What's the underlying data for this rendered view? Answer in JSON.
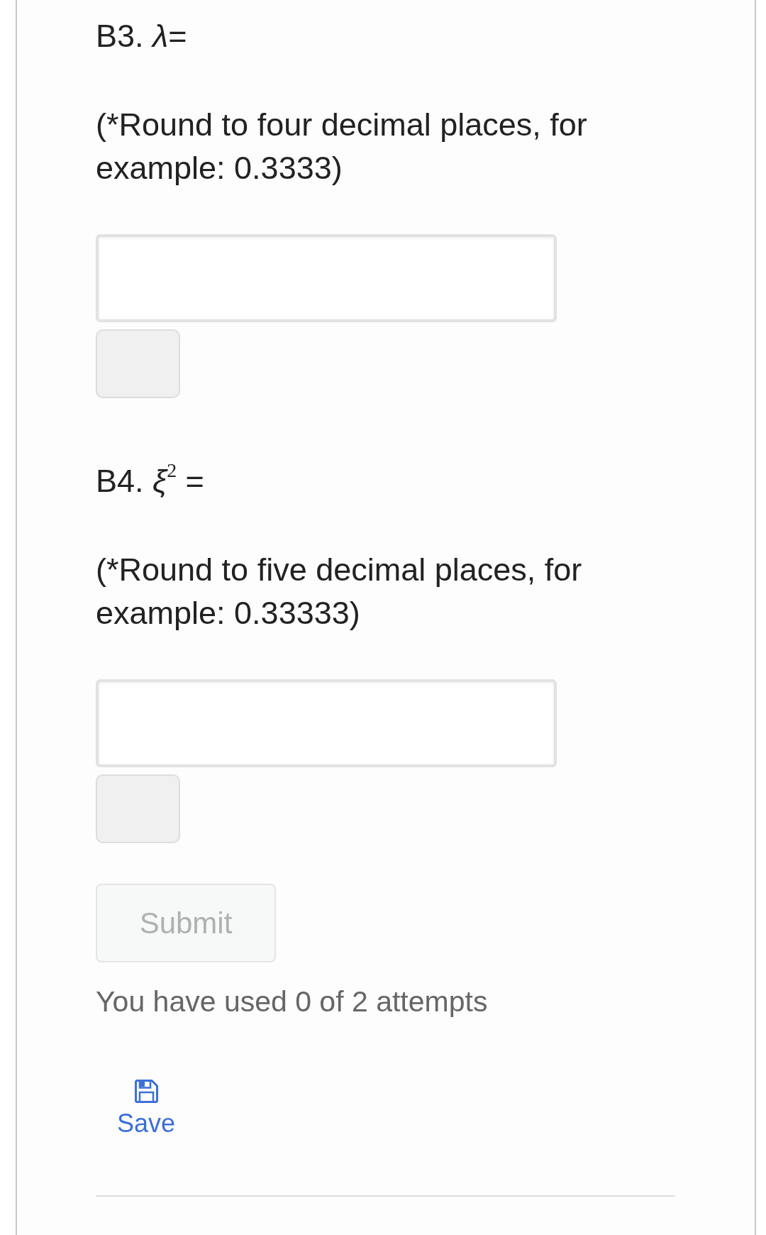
{
  "questions": [
    {
      "prompt": "B3. *λ*=",
      "instruction": "(*Round to four decimal places, for example: 0.3333)"
    },
    {
      "prompt": "B4. *ξ*$^{2}$ =",
      "instruction": "(*Round to five decimal places, for example: 0.33333)"
    }
  ],
  "submit_button": {
    "label": "Submit",
    "disabled": true
  },
  "attempts_note": "You have used 0 of 2 attempts",
  "save_button": {
    "label": "Save"
  }
}
